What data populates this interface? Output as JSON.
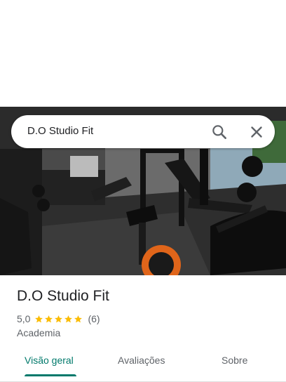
{
  "search": {
    "query": "D.O Studio Fit"
  },
  "icons": {
    "search": "search-icon",
    "close": "close-icon",
    "star": "star-icon"
  },
  "place": {
    "name": "D.O Studio Fit",
    "rating": "5,0",
    "stars": 5,
    "review_count": "(6)",
    "category": "Academia"
  },
  "tabs": [
    {
      "label": "Visão geral",
      "active": true
    },
    {
      "label": "Avaliações",
      "active": false
    },
    {
      "label": "Sobre",
      "active": false
    }
  ],
  "colors": {
    "accent": "#00796b",
    "star": "#fbbc04",
    "text_primary": "#202124",
    "text_secondary": "#5f6368"
  }
}
